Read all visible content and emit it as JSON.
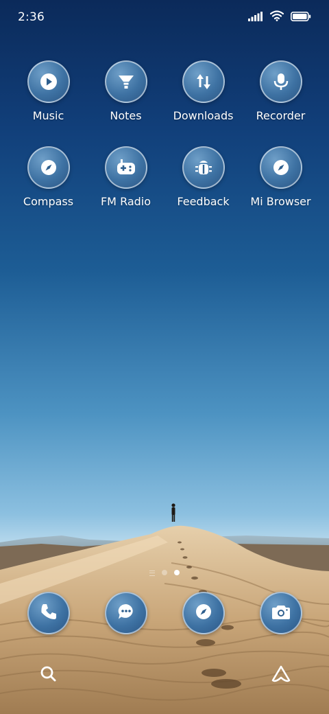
{
  "status_bar": {
    "time": "2:36",
    "icons": [
      "signal-icon",
      "wifi-icon",
      "battery-icon"
    ]
  },
  "apps": [
    {
      "label": "Music",
      "icon": "play-icon"
    },
    {
      "label": "Notes",
      "icon": "funnel-icon"
    },
    {
      "label": "Downloads",
      "icon": "transfer-icon"
    },
    {
      "label": "Recorder",
      "icon": "microphone-icon"
    },
    {
      "label": "Compass",
      "icon": "compass-icon"
    },
    {
      "label": "FM Radio",
      "icon": "gamepad-icon"
    },
    {
      "label": "Feedback",
      "icon": "bug-icon"
    },
    {
      "label": "Mi Browser",
      "icon": "compass-icon"
    }
  ],
  "page_indicator": {
    "pages": 3,
    "active": 3
  },
  "dock": [
    {
      "icon": "phone-icon"
    },
    {
      "icon": "chat-bubble-icon"
    },
    {
      "icon": "compass-icon"
    },
    {
      "icon": "camera-icon"
    }
  ],
  "bottom_bar": {
    "left_icon": "search-icon",
    "right_icon": "assistant-icon"
  },
  "colors": {
    "icon_fill": "#3e72a3",
    "sky_top": "#0b2a5a",
    "sand": "#d9b98e"
  }
}
